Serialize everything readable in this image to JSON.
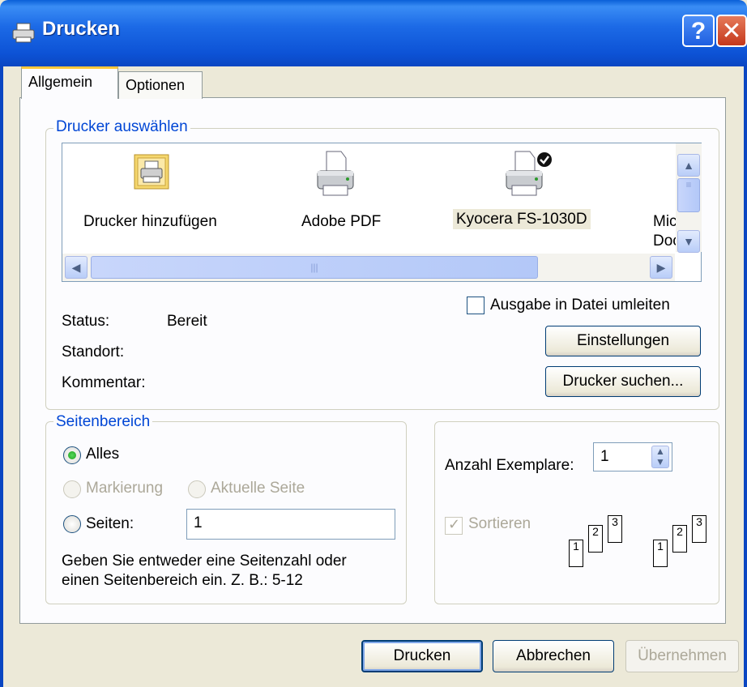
{
  "window": {
    "title": "Drucken"
  },
  "tabs": [
    {
      "label": "Allgemein",
      "active": true
    },
    {
      "label": "Optionen",
      "active": false
    }
  ],
  "printer_group": {
    "legend": "Drucker auswählen",
    "printers": [
      {
        "label": "Drucker hinzufügen",
        "icon": "add-printer-icon"
      },
      {
        "label": "Adobe PDF",
        "icon": "printer-icon"
      },
      {
        "label": "Kyocera FS-1030D",
        "icon": "printer-default-icon",
        "selected": true
      },
      {
        "label": "Mic",
        "label2": "Doc",
        "icon": "printer-icon"
      }
    ],
    "status_label": "Status:",
    "status_value": "Bereit",
    "location_label": "Standort:",
    "comment_label": "Kommentar:",
    "print_to_file_label": "Ausgabe in Datei umleiten",
    "preferences_button": "Einstellungen",
    "find_printer_button": "Drucker suchen..."
  },
  "page_range": {
    "legend": "Seitenbereich",
    "all_label": "Alles",
    "selection_label": "Markierung",
    "current_page_label": "Aktuelle Seite",
    "pages_label": "Seiten:",
    "pages_value": "1",
    "hint_line1": "Geben Sie entweder eine Seitenzahl oder",
    "hint_line2": "einen Seitenbereich ein. Z. B.: 5-12"
  },
  "copies": {
    "count_label": "Anzahl Exemplare:",
    "count_value": "1",
    "collate_label": "Sortieren",
    "page_numbers": [
      "1",
      "2",
      "3"
    ]
  },
  "buttons": {
    "print": "Drucken",
    "cancel": "Abbrechen",
    "apply": "Übernehmen"
  },
  "colors": {
    "title_bar": "#0a5fd8",
    "group_legend": "#0046d5",
    "dialog_bg": "#ece9d8",
    "radio_selected": "#2fb835"
  }
}
